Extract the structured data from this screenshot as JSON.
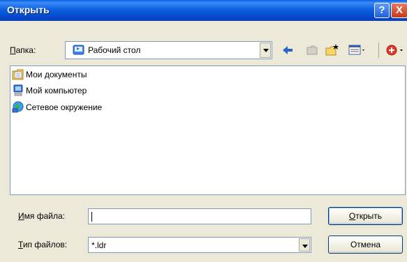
{
  "window": {
    "title": "Открыть"
  },
  "title_buttons": {
    "help": "?",
    "close": "X"
  },
  "lookin": {
    "label_prefix": "",
    "label_accel": "П",
    "label_rest": "апка:",
    "value": "Рабочий стол"
  },
  "toolbar": {
    "icons": [
      "back-icon",
      "up-folder-icon",
      "new-folder-icon",
      "view-menu-icon",
      "add-icon"
    ]
  },
  "files": [
    {
      "name": "Мои документы",
      "icon": "my-documents-icon"
    },
    {
      "name": "Мой компьютер",
      "icon": "my-computer-icon"
    },
    {
      "name": "Сетевое окружение",
      "icon": "network-icon"
    }
  ],
  "filename": {
    "label_accel": "И",
    "label_rest": "мя файла:",
    "value": ""
  },
  "filetype": {
    "label_accel": "Т",
    "label_rest": "ип файлов:",
    "value": "*.ldr"
  },
  "buttons": {
    "open_accel": "О",
    "open_rest": "ткрыть",
    "cancel": "Отмена"
  }
}
